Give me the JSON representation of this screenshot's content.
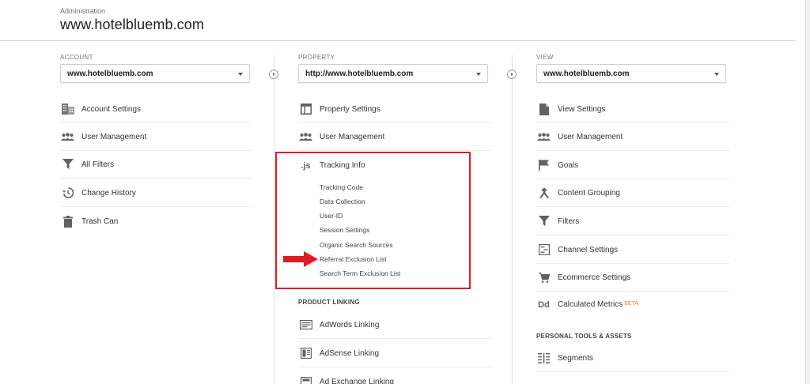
{
  "header": {
    "breadcrumb": "Administration",
    "title": "www.hotelbluemb.com"
  },
  "account": {
    "label": "ACCOUNT",
    "selected": "www.hotelbluemb.com",
    "items": [
      {
        "label": "Account Settings",
        "icon": "building-icon"
      },
      {
        "label": "User Management",
        "icon": "users-icon"
      },
      {
        "label": "All Filters",
        "icon": "filter-icon"
      },
      {
        "label": "Change History",
        "icon": "history-icon"
      },
      {
        "label": "Trash Can",
        "icon": "trash-icon"
      }
    ]
  },
  "property": {
    "label": "PROPERTY",
    "selected": "http://www.hotelbluemb.com",
    "items": [
      {
        "label": "Property Settings",
        "icon": "window-icon"
      },
      {
        "label": "User Management",
        "icon": "users-icon"
      },
      {
        "label": "Tracking Info",
        "icon": "js-icon",
        "icon_text": ".js"
      }
    ],
    "tracking_sub": [
      "Tracking Code",
      "Data Collection",
      "User-ID",
      "Session Settings",
      "Organic Search Sources",
      "Referral Exclusion List",
      "Search Term Exclusion List"
    ],
    "product_linking": {
      "heading": "PRODUCT LINKING",
      "items": [
        {
          "label": "AdWords Linking",
          "icon": "adwords-icon"
        },
        {
          "label": "AdSense Linking",
          "icon": "adsense-icon"
        },
        {
          "label": "Ad Exchange Linking",
          "icon": "adexchange-icon"
        }
      ]
    }
  },
  "view": {
    "label": "VIEW",
    "selected": "www.hotelbluemb.com",
    "items": [
      {
        "label": "View Settings",
        "icon": "document-icon"
      },
      {
        "label": "User Management",
        "icon": "users-icon"
      },
      {
        "label": "Goals",
        "icon": "flag-icon"
      },
      {
        "label": "Content Grouping",
        "icon": "grouping-icon"
      },
      {
        "label": "Filters",
        "icon": "filter-icon"
      },
      {
        "label": "Channel Settings",
        "icon": "channel-icon"
      },
      {
        "label": "Ecommerce Settings",
        "icon": "cart-icon"
      },
      {
        "label": "Calculated Metrics",
        "icon": "dd-icon",
        "icon_text": "Dd",
        "badge": "BETA"
      }
    ],
    "personal_tools": {
      "heading": "PERSONAL TOOLS & ASSETS",
      "items": [
        {
          "label": "Segments",
          "icon": "segments-icon"
        }
      ]
    }
  },
  "colors": {
    "highlight": "#e01b24",
    "beta": "#f0812b",
    "icon": "#616161"
  }
}
